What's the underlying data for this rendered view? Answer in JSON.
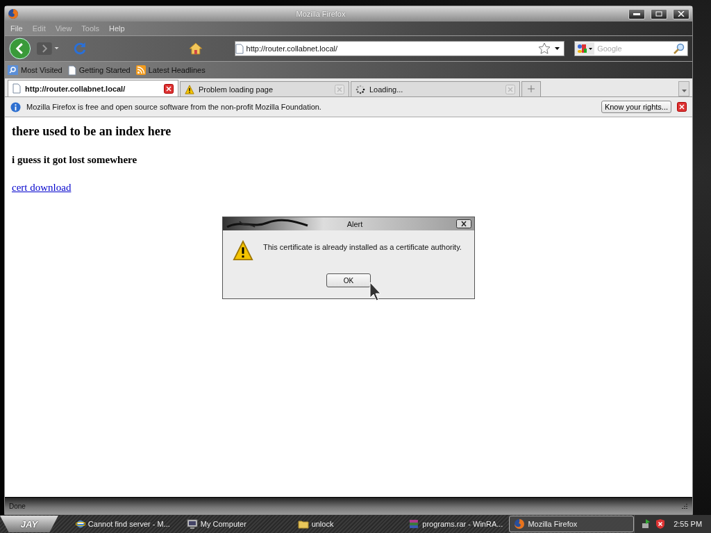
{
  "window": {
    "title": "Mozilla Firefox"
  },
  "menu": [
    "File",
    "Edit",
    "View",
    "Tools",
    "Help"
  ],
  "navigation": {
    "url": "http://router.collabnet.local/",
    "search_placeholder": "Google"
  },
  "bookmarks": [
    {
      "label": "Most Visited",
      "kind": "search"
    },
    {
      "label": "Getting Started",
      "kind": "page"
    },
    {
      "label": "Latest Headlines",
      "kind": "feed"
    }
  ],
  "tabs": [
    {
      "label": "http://router.collabnet.local/",
      "selected": true,
      "kind": "page"
    },
    {
      "label": "Problem loading page",
      "selected": false,
      "kind": "warning"
    },
    {
      "label": "Loading...",
      "selected": false,
      "kind": "loading"
    }
  ],
  "notification": {
    "text": "Mozilla Firefox is free and open source software from the non-profit Mozilla Foundation.",
    "button": "Know your rights..."
  },
  "content": {
    "heading": "there used to be an index here",
    "subheading": "i guess it got lost somewhere",
    "link": "cert download"
  },
  "dialog": {
    "title": "Alert",
    "message": "This certificate is already installed as a certificate authority.",
    "button": "OK"
  },
  "status_bar": {
    "text": "Done"
  },
  "taskbar": {
    "start_label": "JAY",
    "items": [
      {
        "label": "Cannot find server - M...",
        "kind": "ie",
        "selected": false
      },
      {
        "label": "My Computer",
        "kind": "computer",
        "selected": false
      },
      {
        "label": "unlock",
        "kind": "folder",
        "selected": false
      },
      {
        "label": "programs.rar - WinRA...",
        "kind": "archive",
        "selected": false
      },
      {
        "label": "Mozilla Firefox",
        "kind": "firefox",
        "selected": true
      }
    ],
    "clock": "2:55 PM"
  }
}
